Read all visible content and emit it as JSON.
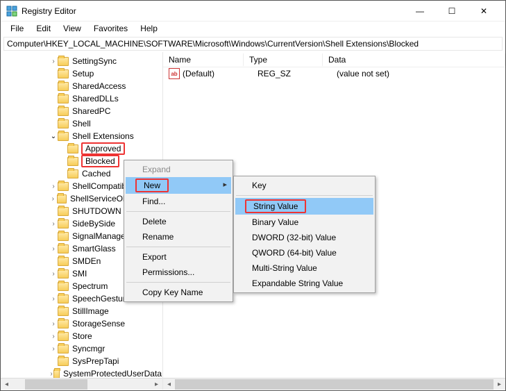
{
  "window": {
    "title": "Registry Editor",
    "controls": {
      "min": "—",
      "max": "☐",
      "close": "✕"
    }
  },
  "menu": [
    "File",
    "Edit",
    "View",
    "Favorites",
    "Help"
  ],
  "address": "Computer\\HKEY_LOCAL_MACHINE\\SOFTWARE\\Microsoft\\Windows\\CurrentVersion\\Shell Extensions\\Blocked",
  "tree": {
    "items": [
      {
        "indent": 4,
        "caret": ">",
        "label": "SettingSync"
      },
      {
        "indent": 4,
        "caret": "",
        "label": "Setup"
      },
      {
        "indent": 4,
        "caret": "",
        "label": "SharedAccess"
      },
      {
        "indent": 4,
        "caret": "",
        "label": "SharedDLLs"
      },
      {
        "indent": 4,
        "caret": "",
        "label": "SharedPC"
      },
      {
        "indent": 4,
        "caret": "",
        "label": "Shell"
      },
      {
        "indent": 4,
        "caret": "v",
        "label": "Shell Extensions"
      },
      {
        "indent": 5,
        "caret": "",
        "label": "Approved",
        "sel": true
      },
      {
        "indent": 5,
        "caret": "",
        "label": "Blocked",
        "sel": true
      },
      {
        "indent": 5,
        "caret": "",
        "label": "Cached"
      },
      {
        "indent": 4,
        "caret": ">",
        "label": "ShellCompatibility"
      },
      {
        "indent": 4,
        "caret": ">",
        "label": "ShellServiceObjectDelay"
      },
      {
        "indent": 4,
        "caret": "",
        "label": "SHUTDOWN"
      },
      {
        "indent": 4,
        "caret": ">",
        "label": "SideBySide"
      },
      {
        "indent": 4,
        "caret": "",
        "label": "SignalManager"
      },
      {
        "indent": 4,
        "caret": ">",
        "label": "SmartGlass"
      },
      {
        "indent": 4,
        "caret": "",
        "label": "SMDEn"
      },
      {
        "indent": 4,
        "caret": ">",
        "label": "SMI"
      },
      {
        "indent": 4,
        "caret": "",
        "label": "Spectrum"
      },
      {
        "indent": 4,
        "caret": ">",
        "label": "SpeechGestures"
      },
      {
        "indent": 4,
        "caret": "",
        "label": "StillImage"
      },
      {
        "indent": 4,
        "caret": ">",
        "label": "StorageSense"
      },
      {
        "indent": 4,
        "caret": ">",
        "label": "Store"
      },
      {
        "indent": 4,
        "caret": ">",
        "label": "Syncmgr"
      },
      {
        "indent": 4,
        "caret": "",
        "label": "SysPrepTapi"
      },
      {
        "indent": 4,
        "caret": ">",
        "label": "SystemProtectedUserData"
      }
    ]
  },
  "list": {
    "headers": {
      "name": "Name",
      "type": "Type",
      "data": "Data"
    },
    "rows": [
      {
        "icon": "ab",
        "name": "(Default)",
        "type": "REG_SZ",
        "data": "(value not set)"
      }
    ]
  },
  "context1": {
    "items": [
      {
        "label": "Expand",
        "disabled": true
      },
      {
        "label": "New",
        "highlight": true,
        "box": true,
        "sub": true
      },
      {
        "label": "Find..."
      },
      {
        "sep": true
      },
      {
        "label": "Delete"
      },
      {
        "label": "Rename"
      },
      {
        "sep": true
      },
      {
        "label": "Export"
      },
      {
        "label": "Permissions..."
      },
      {
        "sep": true
      },
      {
        "label": "Copy Key Name"
      }
    ]
  },
  "context2": {
    "items": [
      {
        "label": "Key"
      },
      {
        "sep": true
      },
      {
        "label": "String Value",
        "highlight": true,
        "box": true
      },
      {
        "label": "Binary Value"
      },
      {
        "label": "DWORD (32-bit) Value"
      },
      {
        "label": "QWORD (64-bit) Value"
      },
      {
        "label": "Multi-String Value"
      },
      {
        "label": "Expandable String Value"
      }
    ]
  }
}
